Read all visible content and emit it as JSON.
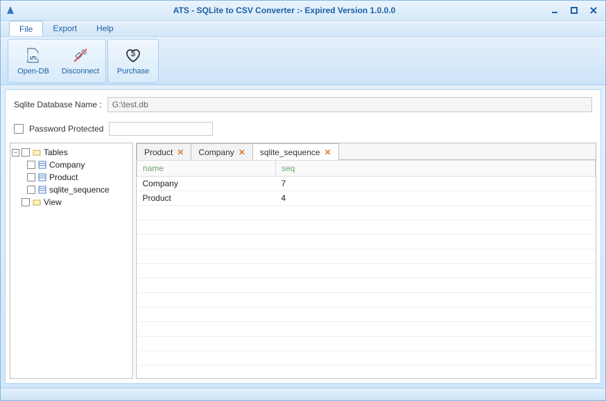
{
  "window": {
    "title": "ATS - SQLite to CSV Converter :- Expired Version 1.0.0.0"
  },
  "menu": {
    "items": [
      "File",
      "Export",
      "Help"
    ],
    "active_index": 0
  },
  "ribbon": {
    "open_db": "Open-DB",
    "disconnect": "Disconnect",
    "purchase": "Purchase"
  },
  "fields": {
    "db_label": "Sqlite Database Name :",
    "db_value": "G:\\test.db",
    "password_label": "Password Protected",
    "password_value": ""
  },
  "tree": {
    "nodes": [
      {
        "label": "Tables",
        "folder": true,
        "expanded": true
      },
      {
        "label": "Company",
        "folder": false
      },
      {
        "label": "Product",
        "folder": false
      },
      {
        "label": "sqlite_sequence",
        "folder": false
      },
      {
        "label": "View",
        "folder": true,
        "expanded": false
      }
    ]
  },
  "tabs": [
    {
      "label": "Product",
      "active": false
    },
    {
      "label": "Company",
      "active": false
    },
    {
      "label": "sqlite_sequence",
      "active": true
    }
  ],
  "grid": {
    "columns": [
      "name",
      "seq"
    ],
    "rows": [
      {
        "name": "Company",
        "seq": "7"
      },
      {
        "name": "Product",
        "seq": "4"
      }
    ]
  }
}
